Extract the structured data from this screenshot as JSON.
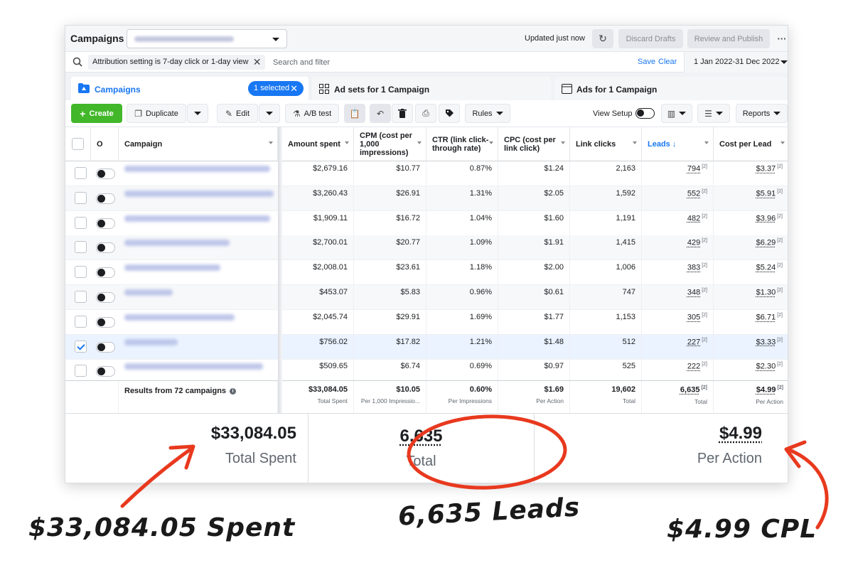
{
  "topbar": {
    "title": "Campaigns",
    "updated": "Updated just now",
    "discard": "Discard Drafts",
    "review": "Review and Publish",
    "more": "···"
  },
  "search": {
    "chip": "Attribution setting is 7-day click or 1-day view",
    "placeholder": "Search and filter",
    "save": "Save",
    "clear": "Clear",
    "date_range": "1 Jan 2022-31 Dec 2022"
  },
  "tabs": {
    "campaigns": "Campaigns",
    "selected": "1 selected",
    "adsets": "Ad sets for 1 Campaign",
    "ads": "Ads for 1 Campaign"
  },
  "toolbar": {
    "create": "Create",
    "duplicate": "Duplicate",
    "edit": "Edit",
    "ab_test": "A/B test",
    "rules": "Rules",
    "view_setup": "View Setup",
    "reports": "Reports"
  },
  "columns": {
    "off_on": "O",
    "campaign": "Campaign",
    "amount_spent": "Amount spent",
    "cpm": "CPM (cost per 1,000 impressions)",
    "ctr": "CTR (link click-through rate)",
    "cpc": "CPC (cost per link click)",
    "link_clicks": "Link clicks",
    "leads": "Leads ↓",
    "cost_per_lead": "Cost per Lead"
  },
  "rows": [
    {
      "spent": "$2,679.16",
      "cpm": "$10.77",
      "ctr": "0.87%",
      "cpc": "$1.24",
      "clicks": "2,163",
      "leads": "794",
      "cpl": "$3.37",
      "note": "[2]",
      "checked": false
    },
    {
      "spent": "$3,260.43",
      "cpm": "$26.91",
      "ctr": "1.31%",
      "cpc": "$2.05",
      "clicks": "1,592",
      "leads": "552",
      "cpl": "$5.91",
      "note": "[2]",
      "checked": false
    },
    {
      "spent": "$1,909.11",
      "cpm": "$16.72",
      "ctr": "1.04%",
      "cpc": "$1.60",
      "clicks": "1,191",
      "leads": "482",
      "cpl": "$3.96",
      "note": "[2]",
      "checked": false
    },
    {
      "spent": "$2,700.01",
      "cpm": "$20.77",
      "ctr": "1.09%",
      "cpc": "$1.91",
      "clicks": "1,415",
      "leads": "429",
      "cpl": "$6.29",
      "note": "[2]",
      "checked": false
    },
    {
      "spent": "$2,008.01",
      "cpm": "$23.61",
      "ctr": "1.18%",
      "cpc": "$2.00",
      "clicks": "1,006",
      "leads": "383",
      "cpl": "$5.24",
      "note": "[2]",
      "checked": false
    },
    {
      "spent": "$453.07",
      "cpm": "$5.83",
      "ctr": "0.96%",
      "cpc": "$0.61",
      "clicks": "747",
      "leads": "348",
      "cpl": "$1.30",
      "note": "[2]",
      "checked": false
    },
    {
      "spent": "$2,045.74",
      "cpm": "$29.91",
      "ctr": "1.69%",
      "cpc": "$1.77",
      "clicks": "1,153",
      "leads": "305",
      "cpl": "$6.71",
      "note": "[2]",
      "checked": false
    },
    {
      "spent": "$756.02",
      "cpm": "$17.82",
      "ctr": "1.21%",
      "cpc": "$1.48",
      "clicks": "512",
      "leads": "227",
      "cpl": "$3.33",
      "note": "[2]",
      "checked": true
    },
    {
      "spent": "$509.65",
      "cpm": "$6.74",
      "ctr": "0.69%",
      "cpc": "$0.97",
      "clicks": "525",
      "leads": "222",
      "cpl": "$2.30",
      "note": "[2]",
      "checked": false
    }
  ],
  "totals": {
    "label": "Results from 72 campaigns",
    "spent": "$33,084.05",
    "spent_sub": "Total Spent",
    "cpm": "$10.05",
    "cpm_sub": "Per 1,000 Impressio...",
    "ctr": "0.60%",
    "ctr_sub": "Per Impressions",
    "cpc": "$1.69",
    "cpc_sub": "Per Action",
    "clicks": "19,602",
    "clicks_sub": "Total",
    "leads": "6,635",
    "leads_sub": "Total",
    "cpl": "$4.99",
    "cpl_sub": "Per Action",
    "note": "[2]"
  },
  "zoom": {
    "spent": "$33,084.05",
    "spent_sub": "Total Spent",
    "leads": "6,635",
    "leads_sub": "Total",
    "cpl": "$4.99",
    "cpl_sub": "Per Action"
  },
  "annotations": {
    "spent": "$33,084.05 Spent",
    "leads": "6,635 Leads",
    "cpl": "$4.99 CPL"
  },
  "colors": {
    "accent": "#1877f2",
    "create": "#42b72a",
    "annotation": "#e8391e"
  }
}
